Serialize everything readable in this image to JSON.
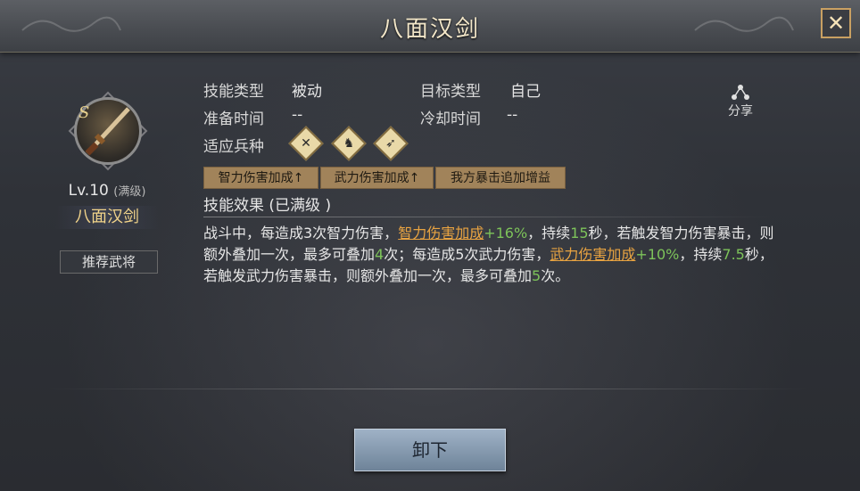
{
  "header": {
    "title": "八面汉剑",
    "close_label": "✕"
  },
  "weapon": {
    "grade": "S",
    "level": "Lv.10",
    "level_max": "(满级)",
    "name": "八面汉剑",
    "recommend_label": "推荐武将"
  },
  "skill": {
    "type_label": "技能类型",
    "type_value": "被动",
    "target_label": "目标类型",
    "target_value": "自己",
    "prep_label": "准备时间",
    "prep_value": "--",
    "cooldown_label": "冷却时间",
    "cooldown_value": "--",
    "troop_label": "适应兵种",
    "troop_icons": [
      "infantry-icon",
      "cavalry-icon",
      "archer-icon"
    ],
    "tags": [
      "智力伤害加成↑",
      "武力伤害加成↑",
      "我方暴击追加增益"
    ],
    "effect_title": "技能效果 (已满级 )"
  },
  "description": {
    "p1": "战斗中，每造成3次智力伤害，",
    "link1": "智力伤害加成",
    "v1": "+16%",
    "p2": "，持续",
    "v2": "15",
    "p3": "秒，若触发智力伤害暴击，则额外叠加一次，最多可叠加",
    "v3": "4",
    "p4": "次；每造成5次武力伤害，",
    "link2": "武力伤害加成",
    "v4": "+10%",
    "p5": "，持续",
    "v5": "7.5",
    "p6": "秒，若触发武力伤害暴击，则额外叠加一次，最多可叠加",
    "v6": "5",
    "p7": "次。"
  },
  "share": {
    "label": "分享"
  },
  "footer": {
    "unequip_label": "卸下"
  },
  "colors": {
    "accent_gold": "#f2d48a",
    "value_green": "#7dc35a",
    "link_orange": "#e8a341",
    "tag_bg": "#a1835a"
  }
}
